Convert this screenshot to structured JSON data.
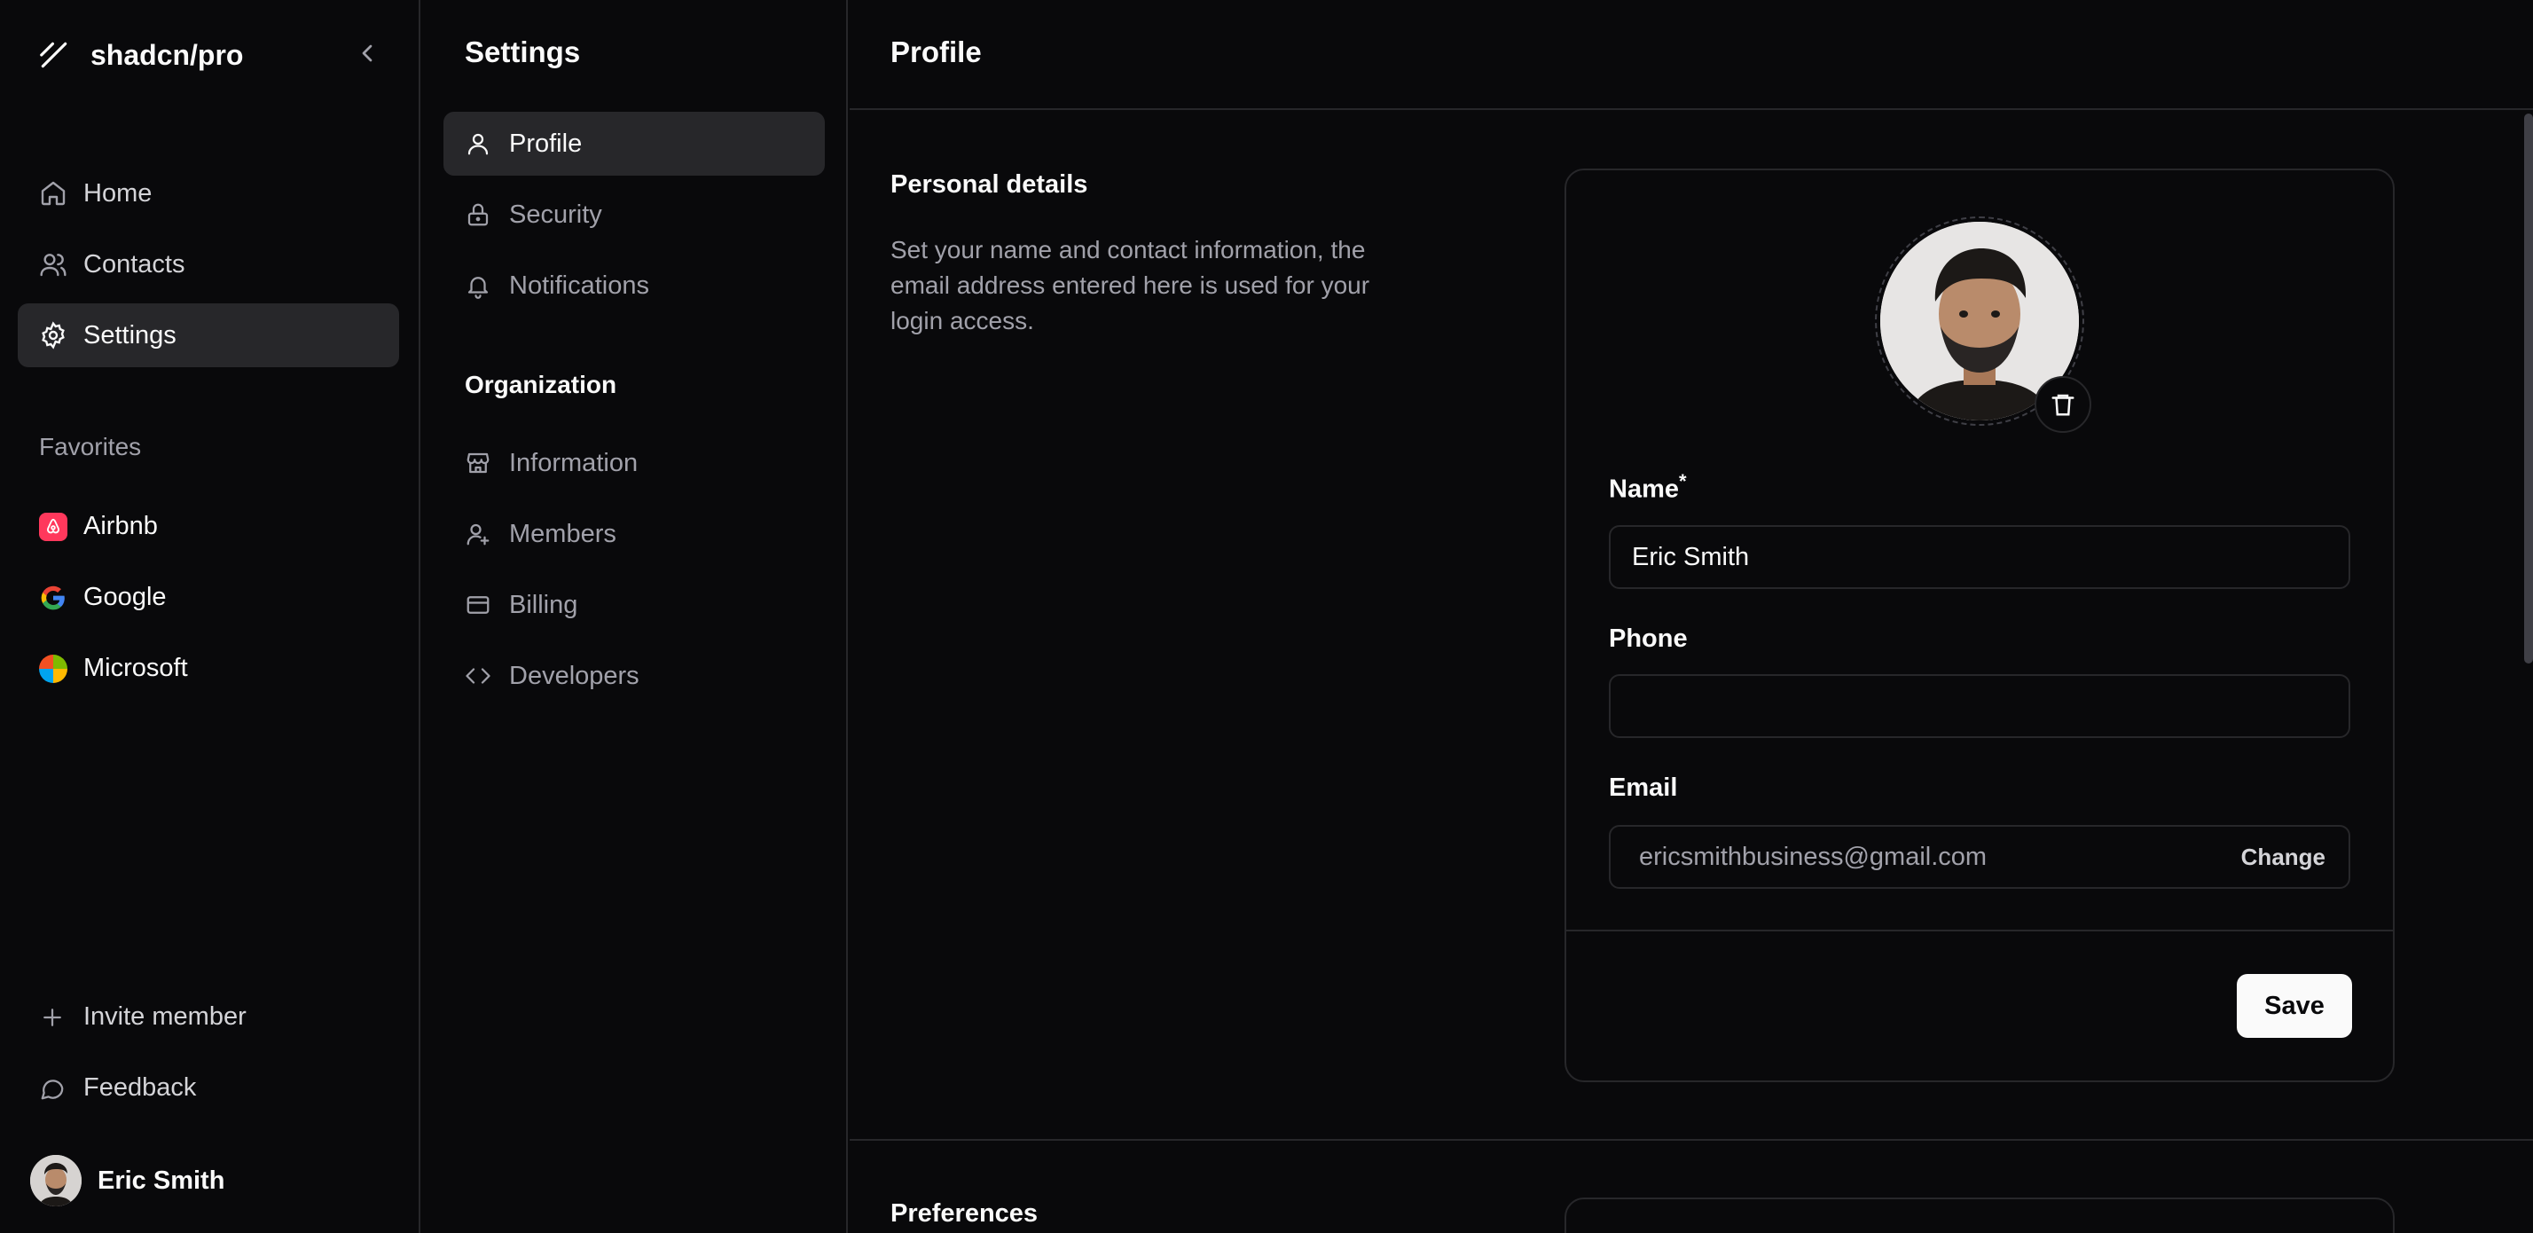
{
  "brand": {
    "name": "shadcn/pro"
  },
  "sidebar": {
    "nav": [
      {
        "label": "Home",
        "icon": "home-icon",
        "active": false
      },
      {
        "label": "Contacts",
        "icon": "users-icon",
        "active": false
      },
      {
        "label": "Settings",
        "icon": "gear-icon",
        "active": true
      }
    ],
    "favorites_title": "Favorites",
    "favorites": [
      {
        "label": "Airbnb",
        "icon": "airbnb-logo-icon",
        "color": "#ff385c"
      },
      {
        "label": "Google",
        "icon": "google-logo-icon",
        "color": "#4285f4"
      },
      {
        "label": "Microsoft",
        "icon": "microsoft-logo-icon",
        "color": "#f25022"
      }
    ],
    "bottom": [
      {
        "label": "Invite member",
        "icon": "plus-icon"
      },
      {
        "label": "Feedback",
        "icon": "message-icon"
      }
    ],
    "user": {
      "name": "Eric Smith"
    }
  },
  "settings_nav": {
    "title": "Settings",
    "items": [
      {
        "label": "Profile",
        "icon": "user-icon",
        "active": true
      },
      {
        "label": "Security",
        "icon": "lock-icon",
        "active": false
      },
      {
        "label": "Notifications",
        "icon": "bell-icon",
        "active": false
      }
    ],
    "org_title": "Organization",
    "org_items": [
      {
        "label": "Information",
        "icon": "store-icon"
      },
      {
        "label": "Members",
        "icon": "user-plus-icon"
      },
      {
        "label": "Billing",
        "icon": "credit-card-icon"
      },
      {
        "label": "Developers",
        "icon": "code-icon"
      }
    ]
  },
  "main": {
    "title": "Profile",
    "personal": {
      "heading": "Personal details",
      "description": "Set your name and contact information, the email address entered here is used for your login access."
    },
    "form": {
      "name_label": "Name",
      "name_required": "*",
      "name_value": "Eric Smith",
      "phone_label": "Phone",
      "phone_value": "",
      "email_label": "Email",
      "email_value": "ericsmithbusiness@gmail.com",
      "change_label": "Change",
      "save_label": "Save"
    },
    "preferences_heading": "Preferences"
  }
}
